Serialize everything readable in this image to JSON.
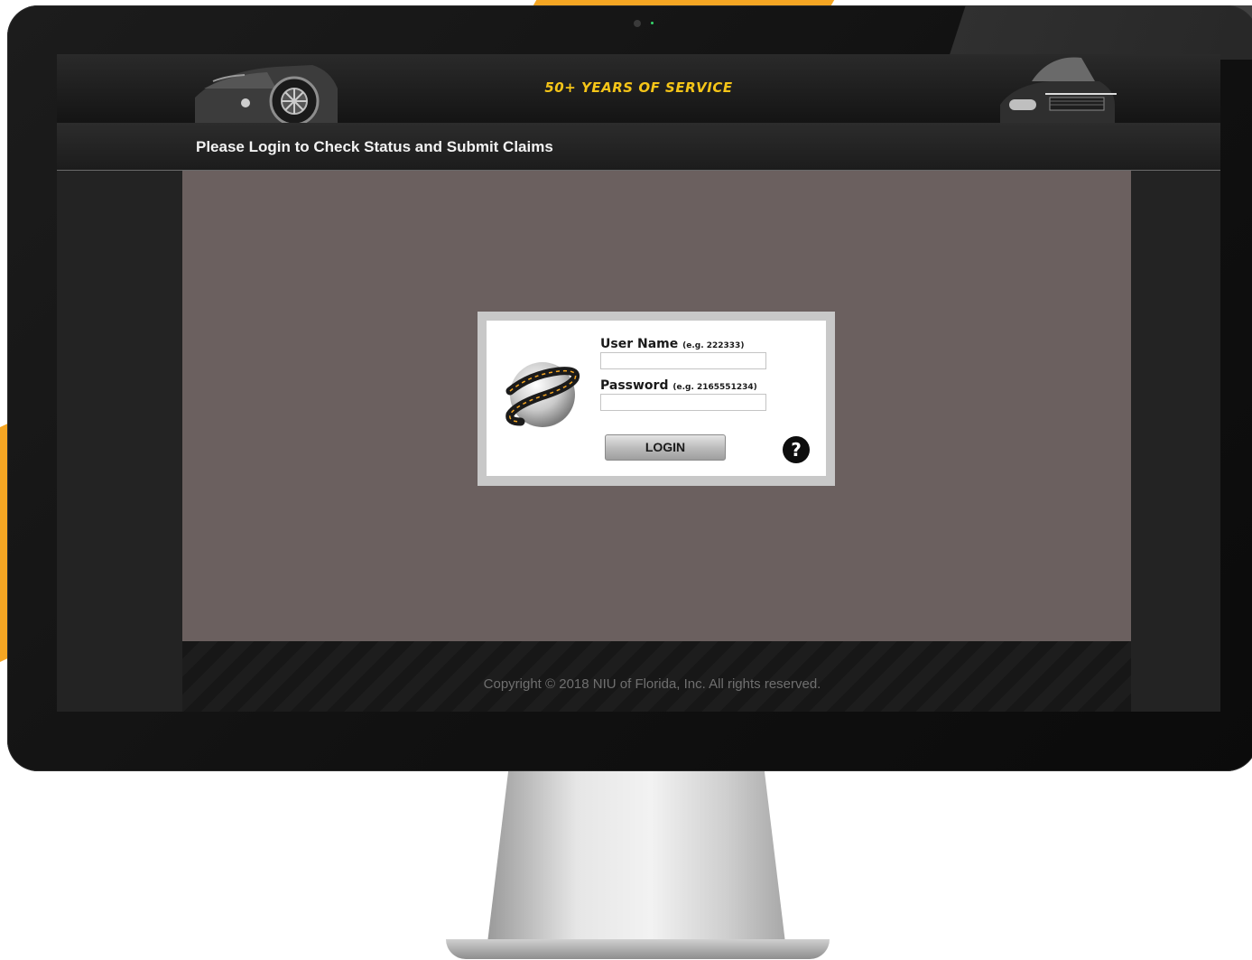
{
  "header": {
    "tagline": "50+ YEARS OF SERVICE"
  },
  "subheader": {
    "title": "Please Login to Check Status and Submit Claims"
  },
  "login": {
    "username_label": "User Name",
    "username_hint": "(e.g. 222333)",
    "username_value": "",
    "password_label": "Password",
    "password_hint": "(e.g. 2165551234)",
    "password_value": "",
    "login_button": "LOGIN",
    "help_icon": "?"
  },
  "footer": {
    "copyright": "Copyright © 2018 NIU of Florida, Inc. All rights reserved."
  },
  "icons": {
    "globe": "globe-road-icon",
    "help": "question-circle-icon"
  },
  "colors": {
    "accent": "#f5a623",
    "tagline": "#f5c518",
    "content_bg": "#6b605f"
  }
}
